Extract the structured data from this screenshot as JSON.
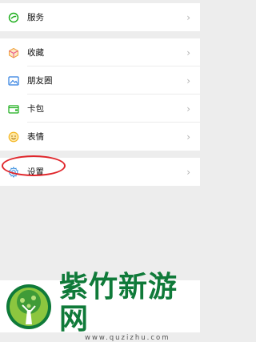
{
  "menu": {
    "group1": [
      {
        "label": "服务",
        "icon": "services-icon"
      }
    ],
    "group2": [
      {
        "label": "收藏",
        "icon": "favorites-icon"
      },
      {
        "label": "朋友圈",
        "icon": "moments-icon"
      },
      {
        "label": "卡包",
        "icon": "cards-icon"
      },
      {
        "label": "表情",
        "icon": "stickers-icon"
      }
    ],
    "group3": [
      {
        "label": "设置",
        "icon": "settings-icon"
      }
    ]
  },
  "chevron": "›",
  "colors": {
    "services": "#1aad19",
    "favorites": "#f0a13b",
    "moments": "#2f7ee0",
    "cards": "#1aad19",
    "stickers": "#f3b31a",
    "settings": "#3b8fe0",
    "highlight": "#e0262b",
    "brand": "#0f7a39"
  },
  "watermark": {
    "name": "紫竹新游网",
    "url": "www.quzizhu.com"
  }
}
